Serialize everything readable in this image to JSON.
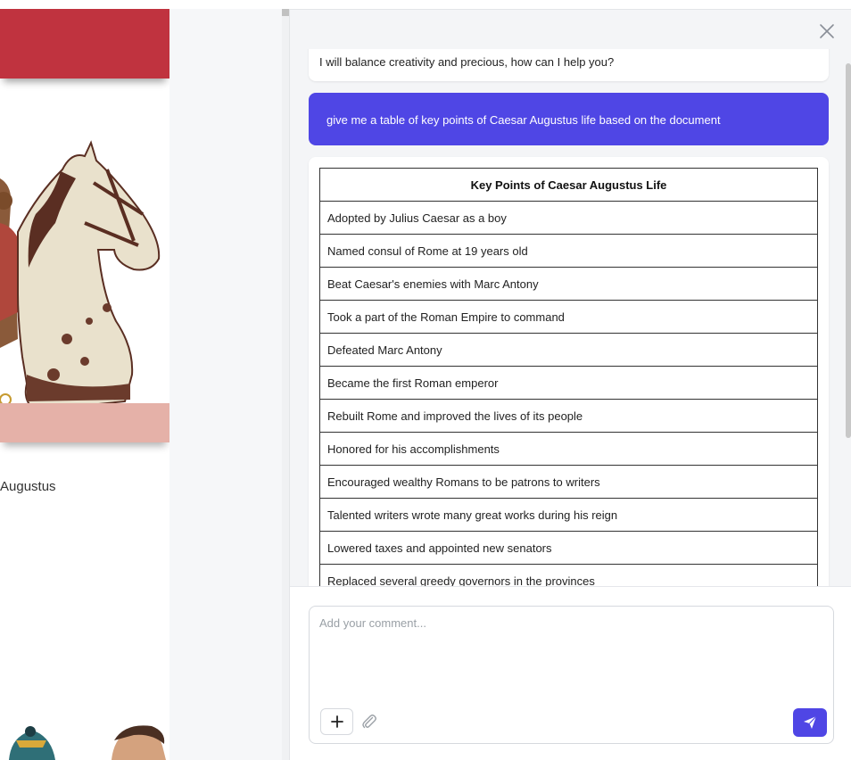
{
  "document": {
    "caption": "Augustus"
  },
  "chat": {
    "close_icon": "close-icon",
    "messages": {
      "ai_greeting": "I will balance creativity and precious, how can I help you?",
      "user_prompt": "give me a table of key points of Caesar Augustus life based on the document",
      "table": {
        "header": "Key Points of Caesar Augustus Life",
        "rows": [
          "Adopted by Julius Caesar as a boy",
          "Named consul of Rome at 19 years old",
          "Beat Caesar's enemies with Marc Antony",
          "Took a part of the Roman Empire to command",
          "Defeated Marc Antony",
          "Became the first Roman emperor",
          "Rebuilt Rome and improved the lives of its people",
          "Honored for his accomplishments",
          "Encouraged wealthy Romans to be patrons to writers",
          "Talented writers wrote many great works during his reign",
          "Lowered taxes and appointed new senators",
          "Replaced several greedy governors in the provinces"
        ]
      }
    },
    "composer": {
      "placeholder": "Add your comment...",
      "plus_icon": "plus-icon",
      "attach_icon": "paperclip-icon",
      "send_icon": "send-icon"
    },
    "colors": {
      "accent": "#4f46e5",
      "document_red": "#c0333f",
      "document_pink": "#e5b1a8"
    }
  }
}
